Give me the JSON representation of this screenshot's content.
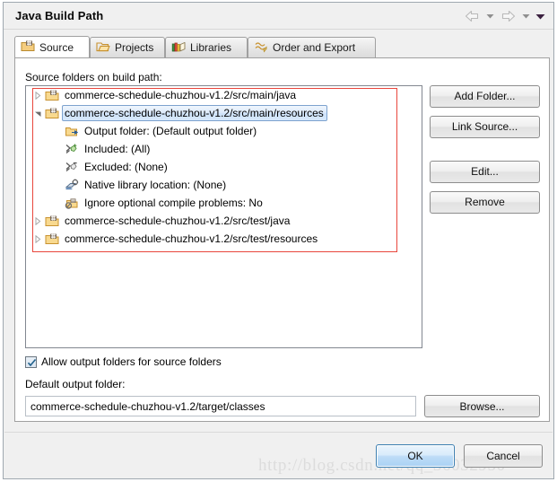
{
  "window": {
    "title": "Java Build Path"
  },
  "titlebar": {
    "back_icon": "back-arrow-icon",
    "back_caret_icon": "chevron-down-icon",
    "forward_icon": "forward-arrow-icon",
    "forward_caret_icon": "chevron-down-icon",
    "menu_caret_icon": "chevron-down-icon"
  },
  "tabs": [
    {
      "label": "Source",
      "icon": "source-folder-icon",
      "active": true
    },
    {
      "label": "Projects",
      "icon": "projects-folder-icon",
      "active": false
    },
    {
      "label": "Libraries",
      "icon": "libraries-books-icon",
      "active": false
    },
    {
      "label": "Order and Export",
      "icon": "order-export-icon",
      "active": false
    }
  ],
  "source_tab": {
    "tree_label": "Source folders on build path:",
    "tree_items": [
      {
        "label": "commerce-schedule-chuzhou-v1.2/src/main/java",
        "icon": "source-folder-icon",
        "twisty": "collapsed",
        "level": 0,
        "selected": false
      },
      {
        "label": "commerce-schedule-chuzhou-v1.2/src/main/resources",
        "icon": "source-folder-icon",
        "twisty": "expanded",
        "level": 0,
        "selected": true
      },
      {
        "label": "Output folder: (Default output folder)",
        "icon": "output-folder-icon",
        "twisty": "none",
        "level": 1,
        "selected": false
      },
      {
        "label": "Included: (All)",
        "icon": "included-filter-icon",
        "twisty": "none",
        "level": 1,
        "selected": false
      },
      {
        "label": "Excluded: (None)",
        "icon": "excluded-filter-icon",
        "twisty": "none",
        "level": 1,
        "selected": false
      },
      {
        "label": "Native library location: (None)",
        "icon": "native-library-icon",
        "twisty": "none",
        "level": 1,
        "selected": false
      },
      {
        "label": "Ignore optional compile problems: No",
        "icon": "ignore-problems-icon",
        "twisty": "none",
        "level": 1,
        "selected": false
      },
      {
        "label": "commerce-schedule-chuzhou-v1.2/src/test/java",
        "icon": "source-folder-icon",
        "twisty": "collapsed",
        "level": 0,
        "selected": false
      },
      {
        "label": "commerce-schedule-chuzhou-v1.2/src/test/resources",
        "icon": "source-folder-icon",
        "twisty": "collapsed",
        "level": 0,
        "selected": false
      }
    ],
    "side_buttons": [
      {
        "label": "Add Folder..."
      },
      {
        "label": "Link Source..."
      },
      {
        "label": "Edit..."
      },
      {
        "label": "Remove"
      }
    ],
    "allow_output_folders": {
      "label": "Allow output folders for source folders",
      "checked": true
    },
    "default_output": {
      "label": "Default output folder:",
      "value": "commerce-schedule-chuzhou-v1.2/target/classes",
      "browse_label": "Browse..."
    }
  },
  "dialog_buttons": {
    "ok": "OK",
    "cancel": "Cancel"
  },
  "watermark": "http://blog.csdn.net/qq_36032950",
  "colors": {
    "annotation_red": "#e8463c",
    "selection_blue": "#cfe3fa",
    "default_button_blue": "#3c7fb1"
  }
}
